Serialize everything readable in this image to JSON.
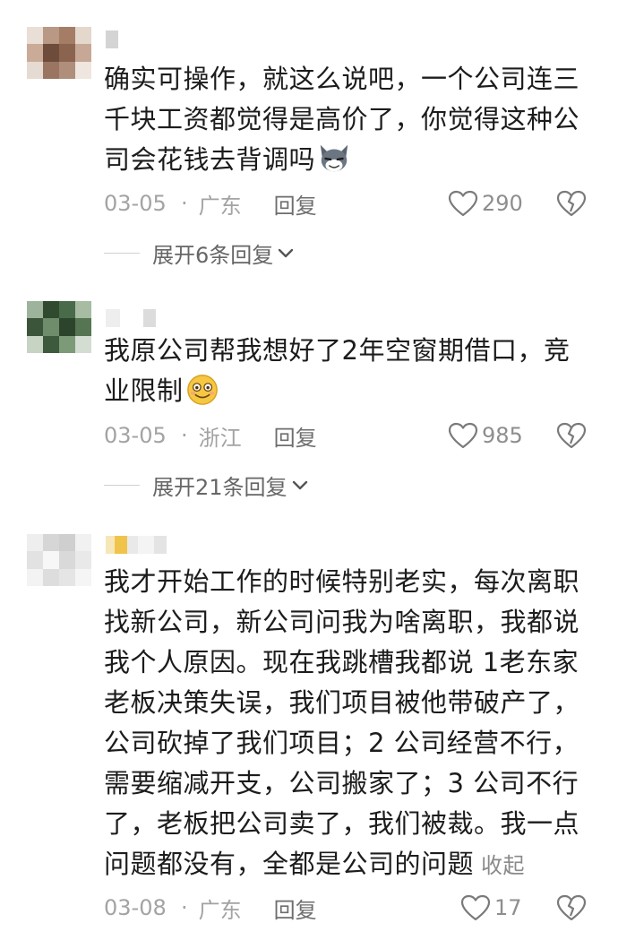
{
  "comments": [
    {
      "text": "确实可操作，就这么说吧，一个公司连三千块工资都觉得是高价了，你觉得这种公司会花钱去背调吗",
      "emoji": "wolf-grin-emoji",
      "date": "03-05",
      "region": "广东",
      "reply_label": "回复",
      "likes": "290",
      "expand_label": "展开6条回复"
    },
    {
      "text": "我原公司帮我想好了2年空窗期借口，竞业限制",
      "emoji": "grin-emoji",
      "date": "03-05",
      "region": "浙江",
      "reply_label": "回复",
      "likes": "985",
      "expand_label": "展开21条回复"
    },
    {
      "text": "我才开始工作的时候特别老实，每次离职找新公司，新公司问我为啥离职，我都说我个人原因。现在我跳槽我都说 1老东家老板决策失误，我们项目被他带破产了，公司砍掉了我们项目；2 公司经营不行，需要缩减开支，公司搬家了；3 公司不行了，老板把公司卖了，我们被裁。我一点问题都没有，全都是公司的问题",
      "collapse_label": "收起",
      "date": "03-08",
      "region": "广东",
      "reply_label": "回复",
      "likes": "17"
    }
  ],
  "separator_dot": "·",
  "colors": {
    "meta_gray": "#a3a3a3",
    "text": "#1c1c1c",
    "icon_gray": "#7a7a7a"
  }
}
